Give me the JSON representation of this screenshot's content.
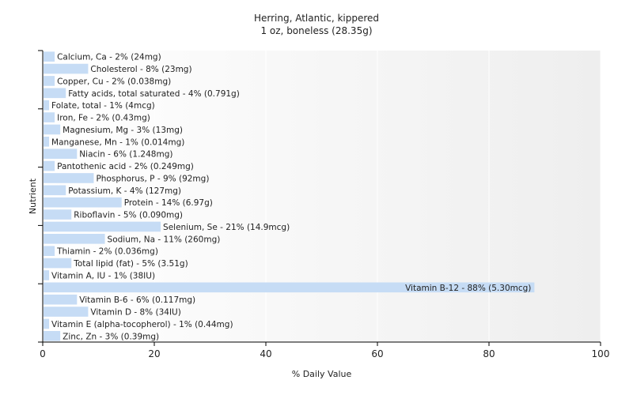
{
  "chart_data": {
    "type": "bar",
    "orientation": "horizontal",
    "title": "Herring, Atlantic, kippered",
    "subtitle": "1 oz, boneless (28.35g)",
    "xlabel": "% Daily Value",
    "ylabel": "Nutrient",
    "xlim": [
      0,
      100
    ],
    "xticks": [
      0,
      20,
      40,
      60,
      80,
      100
    ],
    "grid": true,
    "legend": "none",
    "bar_color": "#c6dcf5",
    "categories": [
      "Calcium, Ca",
      "Cholesterol",
      "Copper, Cu",
      "Fatty acids, total saturated",
      "Folate, total",
      "Iron, Fe",
      "Magnesium, Mg",
      "Manganese, Mn",
      "Niacin",
      "Pantothenic acid",
      "Phosphorus, P",
      "Potassium, K",
      "Protein",
      "Riboflavin",
      "Selenium, Se",
      "Sodium, Na",
      "Thiamin",
      "Total lipid (fat)",
      "Vitamin A, IU",
      "Vitamin B-12",
      "Vitamin B-6",
      "Vitamin D",
      "Vitamin E (alpha-tocopherol)",
      "Zinc, Zn"
    ],
    "values": [
      2,
      8,
      2,
      4,
      1,
      2,
      3,
      1,
      6,
      2,
      9,
      4,
      14,
      5,
      21,
      11,
      2,
      5,
      1,
      88,
      6,
      8,
      1,
      3
    ],
    "data_labels": [
      "Calcium, Ca - 2% (24mg)",
      "Cholesterol - 8% (23mg)",
      "Copper, Cu - 2% (0.038mg)",
      "Fatty acids, total saturated - 4% (0.791g)",
      "Folate, total - 1% (4mcg)",
      "Iron, Fe - 2% (0.43mg)",
      "Magnesium, Mg - 3% (13mg)",
      "Manganese, Mn - 1% (0.014mg)",
      "Niacin - 6% (1.248mg)",
      "Pantothenic acid - 2% (0.249mg)",
      "Phosphorus, P - 9% (92mg)",
      "Potassium, K - 4% (127mg)",
      "Protein - 14% (6.97g)",
      "Riboflavin - 5% (0.090mg)",
      "Selenium, Se - 21% (14.9mcg)",
      "Sodium, Na - 11% (260mg)",
      "Thiamin - 2% (0.036mg)",
      "Total lipid (fat) - 5% (3.51g)",
      "Vitamin A, IU - 1% (38IU)",
      "Vitamin B-12 - 88% (5.30mcg)",
      "Vitamin B-6 - 6% (0.117mg)",
      "Vitamin D - 8% (34IU)",
      "Vitamin E (alpha-tocopherol) - 1% (0.44mg)",
      "Zinc, Zn - 3% (0.39mg)"
    ]
  }
}
